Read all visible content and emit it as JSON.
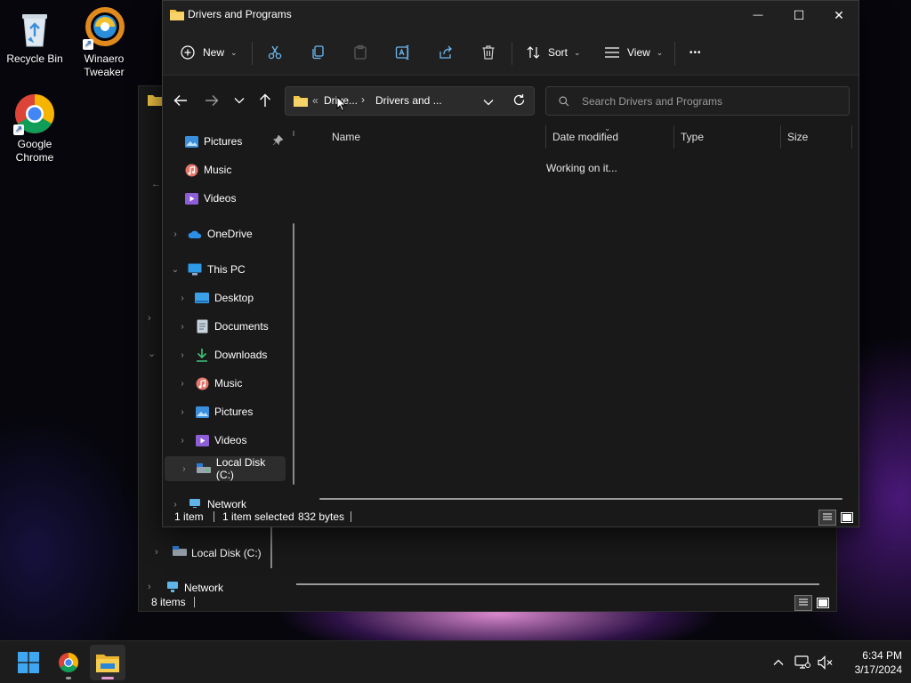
{
  "desktop": {
    "icons": [
      {
        "label": "Recycle Bin"
      },
      {
        "label": "Winaero Tweaker"
      },
      {
        "label": "Google Chrome"
      }
    ]
  },
  "back_window": {
    "nav_items": [
      "Local Disk (C:)",
      "Network",
      "Videos"
    ],
    "status": {
      "item_count": "8 items"
    }
  },
  "front_window": {
    "title": "Drivers and Programs",
    "window_controls": {
      "minimize": "—",
      "maximize": "☐",
      "close": "✕"
    },
    "command_bar": {
      "new_label": "New",
      "sort_label": "Sort",
      "view_label": "View",
      "more_label": "•••"
    },
    "address": {
      "overflow": "«",
      "crumbs": [
        "Drive...",
        "Drivers and ..."
      ]
    },
    "search": {
      "placeholder": "Search Drivers and Programs"
    },
    "nav_pane": {
      "items": [
        {
          "label": "Pictures",
          "icon": "pictures-icon",
          "pinned": true
        },
        {
          "label": "Music",
          "icon": "music-icon"
        },
        {
          "label": "Videos",
          "icon": "videos-icon"
        },
        {
          "label": "OneDrive",
          "icon": "onedrive-icon"
        },
        {
          "label": "This PC",
          "icon": "this-pc-icon"
        },
        {
          "label": "Desktop",
          "icon": "desktop-folder-icon"
        },
        {
          "label": "Documents",
          "icon": "documents-icon"
        },
        {
          "label": "Downloads",
          "icon": "downloads-icon"
        },
        {
          "label": "Music",
          "icon": "music-icon"
        },
        {
          "label": "Pictures",
          "icon": "pictures-icon"
        },
        {
          "label": "Videos",
          "icon": "videos-icon"
        },
        {
          "label": "Local Disk (C:)",
          "icon": "local-disk-icon"
        },
        {
          "label": "Network",
          "icon": "network-icon"
        }
      ]
    },
    "columns": [
      "Name",
      "Date modified",
      "Type",
      "Size"
    ],
    "content_message": "Working on it...",
    "status": {
      "item_count": "1 item",
      "selection": "1 item selected",
      "size": "832 bytes"
    }
  },
  "taskbar": {
    "time": "6:34 PM",
    "date": "3/17/2024"
  },
  "colors": {
    "window_bg": "#191919",
    "titlebar_bg": "#202020",
    "folder_yellow": "#f4c542",
    "taskbar_bg": "#1c1c1c"
  }
}
